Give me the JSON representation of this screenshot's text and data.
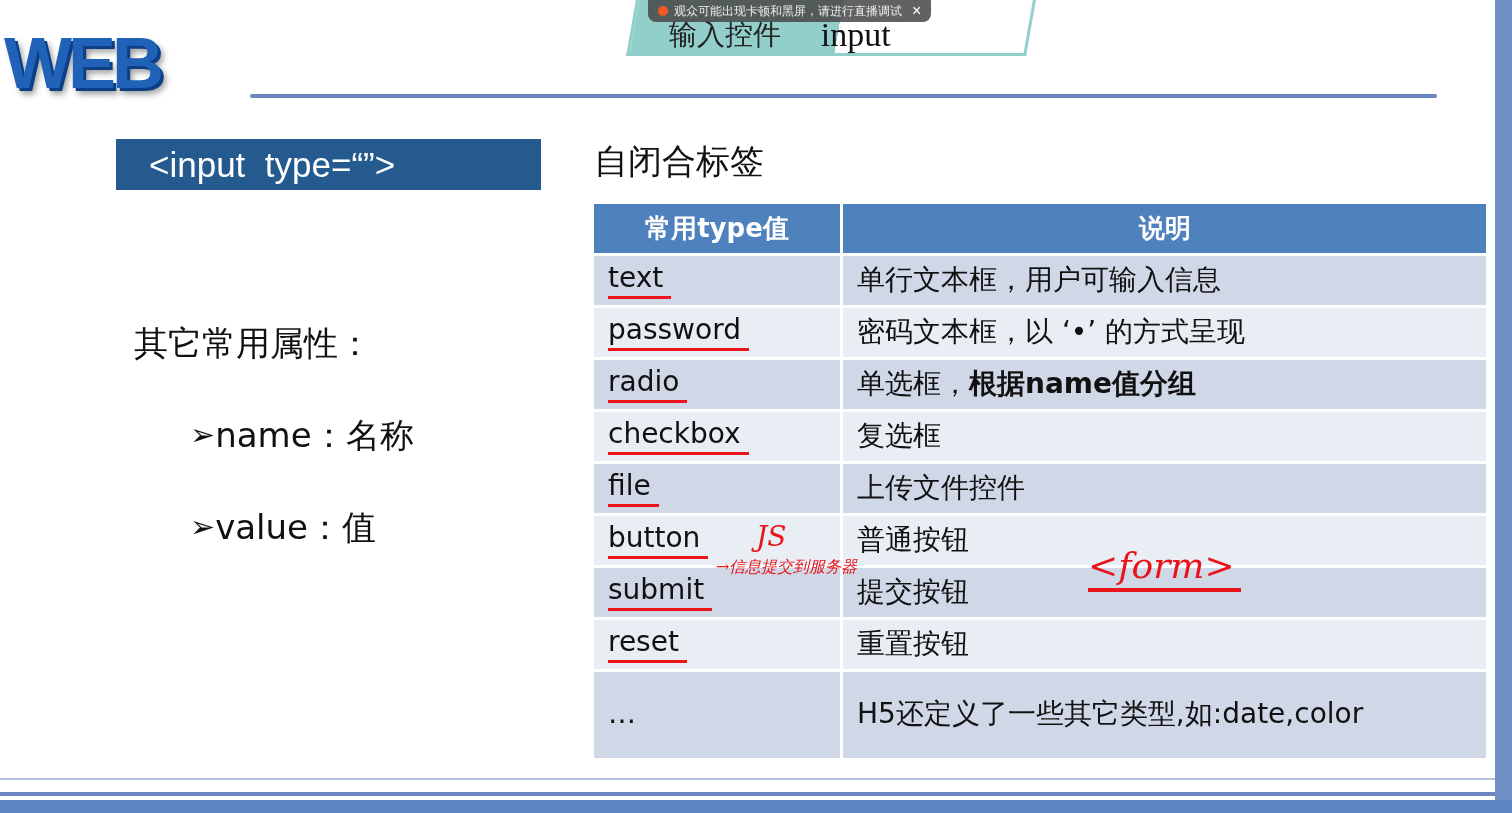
{
  "logo": {
    "text": "WEB"
  },
  "title": {
    "main": "输入控件",
    "sub": "input"
  },
  "toast": {
    "message": "观众可能出现卡顿和黑屏，请进行直播调试",
    "close": "×"
  },
  "syntax_box": {
    "text": "<input  type=“”>"
  },
  "subtitle": "自闭合标签",
  "other_attributes": {
    "heading": "其它常用属性：",
    "items": [
      {
        "bullet": "➢",
        "text": "name：名称"
      },
      {
        "bullet": "➢",
        "text": "value：值"
      }
    ]
  },
  "table": {
    "columns": [
      "常用type值",
      "说明"
    ],
    "rows": [
      {
        "type": "text",
        "description": "单行文本框，用户可输入信息",
        "underlined": true
      },
      {
        "type": "password",
        "description": "密码文本框，以 ‘•’ 的方式呈现",
        "underlined": true
      },
      {
        "type": "radio",
        "description": "单选框，**根据name值分组**",
        "underlined": true
      },
      {
        "type": "checkbox",
        "description": "复选框",
        "underlined": true
      },
      {
        "type": "file",
        "description": "上传文件控件",
        "underlined": true
      },
      {
        "type": "button",
        "description": "普通按钮",
        "underlined": true
      },
      {
        "type": "submit",
        "description": "提交按钮",
        "underlined": true
      },
      {
        "type": "reset",
        "description": "重置按钮",
        "underlined": true
      },
      {
        "type": "…",
        "description": "H5还定义了一些其它类型,如:date,color",
        "underlined": false
      }
    ]
  },
  "annotations": [
    {
      "kind": "note",
      "text": "JS"
    },
    {
      "kind": "note",
      "text": "→信息提交到服务器"
    },
    {
      "kind": "underlined",
      "text": "<form>"
    }
  ]
}
